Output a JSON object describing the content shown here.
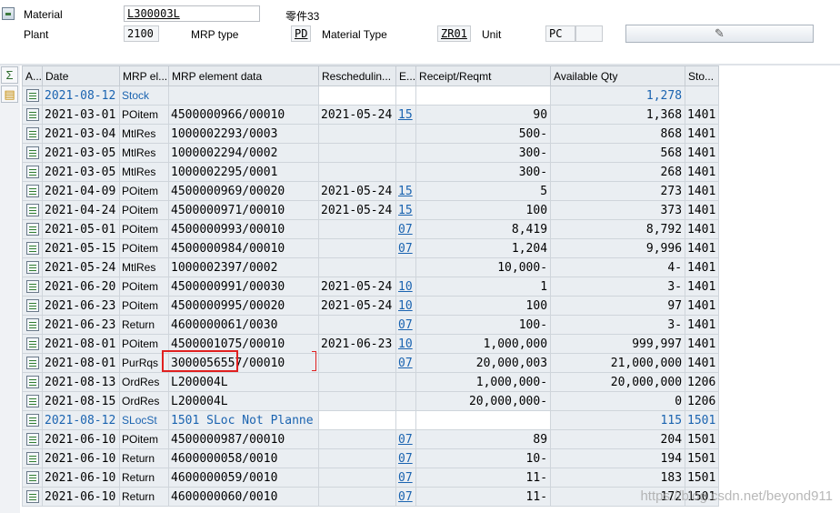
{
  "header": {
    "material_label": "Material",
    "material_value": "L300003L",
    "material_desc": "零件33",
    "plant_label": "Plant",
    "plant_value": "2100",
    "mrp_type_label": "MRP type",
    "mrp_type_value": "PD",
    "material_type_label": "Material Type",
    "material_type_value": "ZR01",
    "unit_label": "Unit",
    "unit_value": "PC",
    "unit_extra": ""
  },
  "left_toolbar": {
    "sum_icon": "sigma-icon",
    "subtotal_icon": "subtotal-icon"
  },
  "columns": [
    "A...",
    "Date",
    "MRP el...",
    "MRP element data",
    "Reschedulin...",
    "E...",
    "Receipt/Reqmt",
    "Available Qty",
    "Sto..."
  ],
  "rows": [
    {
      "date": "2021-08-12",
      "el": "Stock",
      "data": "",
      "resched": "",
      "e": "",
      "receipt": "",
      "avail": "1,278",
      "sto": "",
      "blue": true
    },
    {
      "date": "2021-03-01",
      "el": "POitem",
      "data": "4500000966/00010",
      "resched": "2021-05-24",
      "e": "15",
      "receipt": "90",
      "avail": "1,368",
      "sto": "1401"
    },
    {
      "date": "2021-03-04",
      "el": "MtlRes",
      "data": "1000002293/0003",
      "resched": "",
      "e": "",
      "receipt": "500-",
      "avail": "868",
      "sto": "1401"
    },
    {
      "date": "2021-03-05",
      "el": "MtlRes",
      "data": "1000002294/0002",
      "resched": "",
      "e": "",
      "receipt": "300-",
      "avail": "568",
      "sto": "1401"
    },
    {
      "date": "2021-03-05",
      "el": "MtlRes",
      "data": "1000002295/0001",
      "resched": "",
      "e": "",
      "receipt": "300-",
      "avail": "268",
      "sto": "1401"
    },
    {
      "date": "2021-04-09",
      "el": "POitem",
      "data": "4500000969/00020",
      "resched": "2021-05-24",
      "e": "15",
      "receipt": "5",
      "avail": "273",
      "sto": "1401"
    },
    {
      "date": "2021-04-24",
      "el": "POitem",
      "data": "4500000971/00010",
      "resched": "2021-05-24",
      "e": "15",
      "receipt": "100",
      "avail": "373",
      "sto": "1401"
    },
    {
      "date": "2021-05-01",
      "el": "POitem",
      "data": "4500000993/00010",
      "resched": "",
      "e": "07",
      "receipt": "8,419",
      "avail": "8,792",
      "sto": "1401"
    },
    {
      "date": "2021-05-15",
      "el": "POitem",
      "data": "4500000984/00010",
      "resched": "",
      "e": "07",
      "receipt": "1,204",
      "avail": "9,996",
      "sto": "1401"
    },
    {
      "date": "2021-05-24",
      "el": "MtlRes",
      "data": "1000002397/0002",
      "resched": "",
      "e": "",
      "receipt": "10,000-",
      "avail": "4-",
      "sto": "1401"
    },
    {
      "date": "2021-06-20",
      "el": "POitem",
      "data": "4500000991/00030",
      "resched": "2021-05-24",
      "e": "10",
      "receipt": "1",
      "avail": "3-",
      "sto": "1401"
    },
    {
      "date": "2021-06-23",
      "el": "POitem",
      "data": "4500000995/00020",
      "resched": "2021-05-24",
      "e": "10",
      "receipt": "100",
      "avail": "97",
      "sto": "1401"
    },
    {
      "date": "2021-06-23",
      "el": "Return",
      "data": "4600000061/0030",
      "resched": "",
      "e": "07",
      "receipt": "100-",
      "avail": "3-",
      "sto": "1401"
    },
    {
      "date": "2021-08-01",
      "el": "POitem",
      "data": "4500001075/00010",
      "resched": "2021-06-23",
      "e": "10",
      "receipt": "1,000,000",
      "avail": "999,997",
      "sto": "1401"
    },
    {
      "date": "2021-08-01",
      "el": "PurRqs",
      "data": "3000056557/00010",
      "resched": "",
      "e": "07",
      "receipt": "20,000,003",
      "avail": "21,000,000",
      "sto": "1401"
    },
    {
      "date": "2021-08-13",
      "el": "OrdRes",
      "data": "L200004L",
      "resched": "",
      "e": "",
      "receipt": "1,000,000-",
      "avail": "20,000,000",
      "sto": "1206"
    },
    {
      "date": "2021-08-15",
      "el": "OrdRes",
      "data": "L200004L",
      "resched": "",
      "e": "",
      "receipt": "20,000,000-",
      "avail": "0",
      "sto": "1206"
    },
    {
      "date": "2021-08-12",
      "el": "SLocSt",
      "data": "1501 SLoc Not Planne",
      "resched": "",
      "e": "",
      "receipt": "",
      "avail": "115",
      "sto": "1501",
      "blue": true
    },
    {
      "date": "2021-06-10",
      "el": "POitem",
      "data": "4500000987/00010",
      "resched": "",
      "e": "07",
      "receipt": "89",
      "avail": "204",
      "sto": "1501"
    },
    {
      "date": "2021-06-10",
      "el": "Return",
      "data": "4600000058/0010",
      "resched": "",
      "e": "07",
      "receipt": "10-",
      "avail": "194",
      "sto": "1501"
    },
    {
      "date": "2021-06-10",
      "el": "Return",
      "data": "4600000059/0010",
      "resched": "",
      "e": "07",
      "receipt": "11-",
      "avail": "183",
      "sto": "1501"
    },
    {
      "date": "2021-06-10",
      "el": "Return",
      "data": "4600000060/0010",
      "resched": "",
      "e": "07",
      "receipt": "11-",
      "avail": "172",
      "sto": "1501"
    }
  ],
  "watermark": "https://blog.csdn.net/beyond911"
}
